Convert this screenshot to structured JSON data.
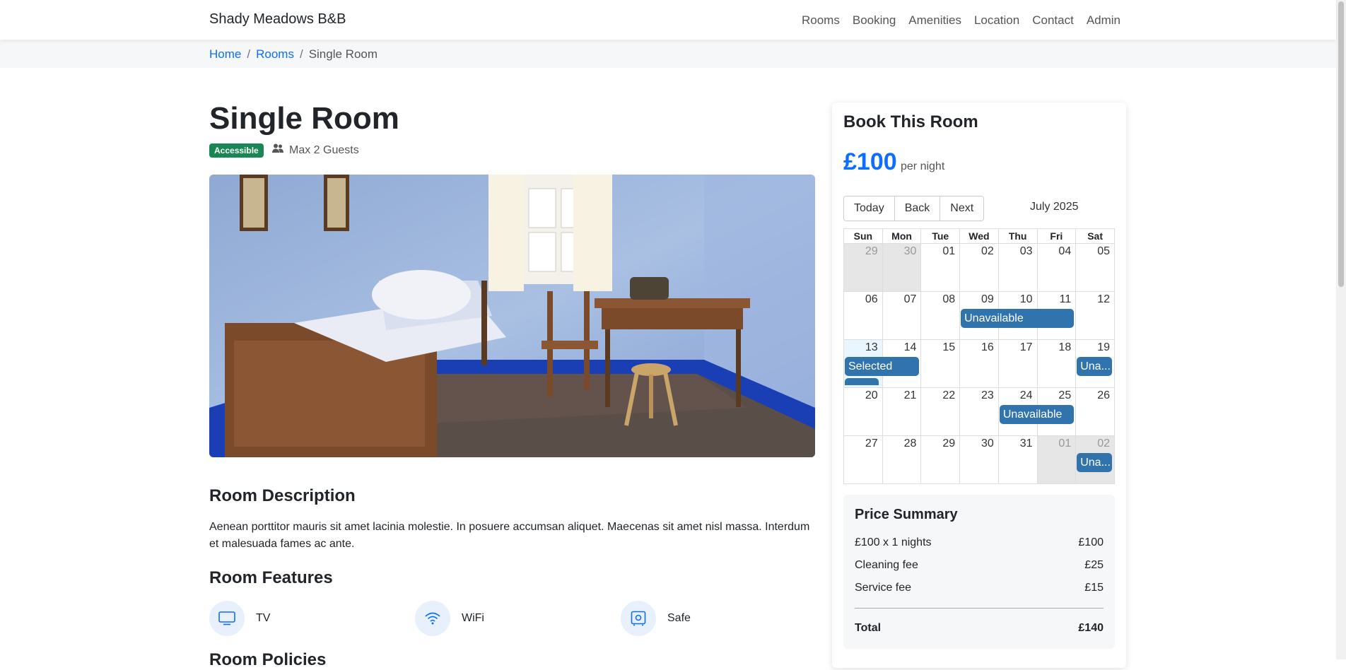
{
  "nav": {
    "brand": "Shady Meadows B&B",
    "links": [
      "Rooms",
      "Booking",
      "Amenities",
      "Location",
      "Contact",
      "Admin"
    ]
  },
  "breadcrumb": {
    "home": "Home",
    "rooms": "Rooms",
    "current": "Single Room",
    "separator": "/"
  },
  "room": {
    "title": "Single Room",
    "badge": "Accessible",
    "guests": "Max 2 Guests",
    "photo_alt": "Room photo",
    "description_heading": "Room Description",
    "description": "Aenean porttitor mauris sit amet lacinia molestie. In posuere accumsan aliquet. Maecenas sit amet nisl massa. Interdum et malesuada fames ac ante.",
    "features_heading": "Room Features",
    "features": [
      {
        "label": "TV",
        "icon": "tv-icon"
      },
      {
        "label": "WiFi",
        "icon": "wifi-icon"
      },
      {
        "label": "Safe",
        "icon": "safe-icon"
      }
    ],
    "policies_heading": "Room Policies"
  },
  "booking": {
    "title": "Book This Room",
    "price": "£100",
    "per_night": "per night",
    "buttons": {
      "today": "Today",
      "back": "Back",
      "next": "Next"
    },
    "month": "July 2025",
    "weekdays": [
      "Sun",
      "Mon",
      "Tue",
      "Wed",
      "Thu",
      "Fri",
      "Sat"
    ],
    "weeks": [
      [
        "29",
        "30",
        "01",
        "02",
        "03",
        "04",
        "05"
      ],
      [
        "06",
        "07",
        "08",
        "09",
        "10",
        "11",
        "12"
      ],
      [
        "13",
        "14",
        "15",
        "16",
        "17",
        "18",
        "19"
      ],
      [
        "20",
        "21",
        "22",
        "23",
        "24",
        "25",
        "26"
      ],
      [
        "27",
        "28",
        "29",
        "30",
        "31",
        "01",
        "02"
      ]
    ],
    "events": {
      "unavailable": "Unavailable",
      "unavailable_short": "Una...",
      "selected": "Selected"
    }
  },
  "summary": {
    "title": "Price Summary",
    "rows": [
      {
        "label": "£100 x 1 nights",
        "value": "£100"
      },
      {
        "label": "Cleaning fee",
        "value": "£25"
      },
      {
        "label": "Service fee",
        "value": "£15"
      }
    ],
    "total_label": "Total",
    "total_value": "£140"
  },
  "colors": {
    "primary": "#0d6efd",
    "badge_green": "#198754",
    "event_blue": "#3174ad"
  }
}
